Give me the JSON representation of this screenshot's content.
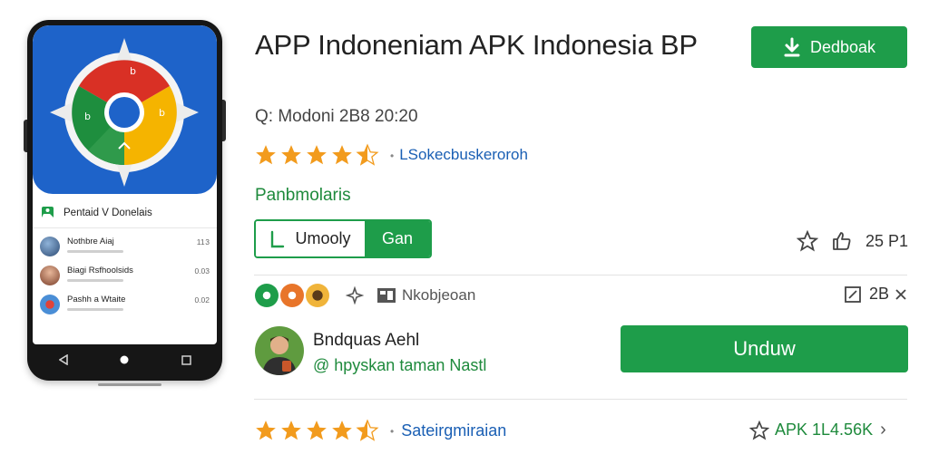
{
  "app": {
    "title": "APP Indoneniam APK Indonesia BP",
    "meta": "Q: Modoni 2B8 20:20",
    "rating_stars": 4.5,
    "rating_link": "LSokecbuskeroroh",
    "category": "Panbmolaris",
    "segment_primary": "Umooly",
    "segment_secondary": "Gan",
    "likes": "25 P1",
    "tag_label": "Nkobjeoan",
    "edit_count": "2B",
    "developer_name": "Bndquas Aehl",
    "developer_handle": "@ hpyskan taman Nastl",
    "bottom_rating_stars": 4.5,
    "bottom_label": "Sateirgmiraian",
    "apk_size": "APK 1L4.56K"
  },
  "buttons": {
    "download_top": "Dedboak",
    "unduh": "Unduw"
  },
  "phone": {
    "app_bar_title": "Pentaid V Donelais",
    "list": [
      {
        "title": "Nothbre Aiaj",
        "meta": "11 3"
      },
      {
        "title": "Biagi Rsfhoolsids",
        "meta": "0.03"
      },
      {
        "title": "Pashh a Wtaite",
        "meta": "0.02"
      }
    ]
  },
  "colors": {
    "brand_green": "#1e9d4a",
    "link_blue": "#1a5fb4",
    "star_orange": "#f29b1d",
    "icon_blue": "#1e63c9"
  },
  "icons": {
    "download": "download-arrow-icon",
    "star": "star-icon",
    "like": "thumbs-up-icon",
    "edit": "edit-square-icon",
    "close": "close-x-icon",
    "share": "share-icon",
    "grid": "grid-icon"
  }
}
